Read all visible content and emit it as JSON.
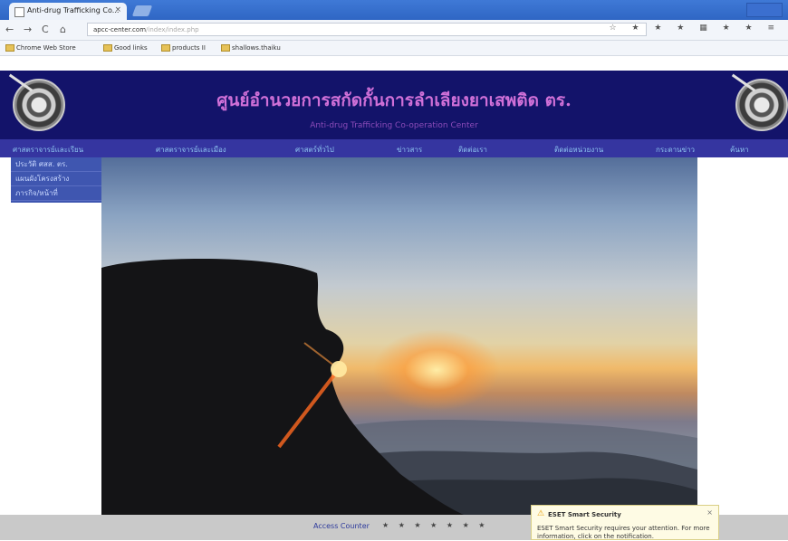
{
  "browser": {
    "tab_title": "Anti-drug Trafficking Co...",
    "tab_close": "×",
    "url_host": "apcc-center.com",
    "url_path": "/index/index.php",
    "nav": {
      "back": "←",
      "forward": "→",
      "reload": "C",
      "home": "⌂"
    },
    "toolbar_icons": "☆ ★ ★ ★ ▦ ★ ★ ≡",
    "bookmarks": [
      "Chrome Web Store",
      "Good links",
      "products II",
      "shallows.thaiku"
    ]
  },
  "page": {
    "title": "ศูนย์อำนวยการสกัดกั้นการลำเลียงยาเสพติด ตร.",
    "subtitle": "Anti-drug Trafficking Co-operation Center",
    "menu": [
      "ศาสตราจารย์และเรียน",
      "ศาสตราจารย์และเมือง",
      "ศาสตร์ทั่วไป",
      "ข่าวสาร",
      "ติดต่อเรา",
      "ติดต่อหน่วยงาน",
      "กระดานข่าว",
      "ค้นหา"
    ],
    "submenu": [
      "ประวัติ ศสส. ตร.",
      "แผนผังโครงสร้าง",
      "ภารกิจ/หน้าที่"
    ],
    "footer_link": "Access Counter",
    "footer_glyphs": "★ ★ ★ ★ ★ ★ ★"
  },
  "popup": {
    "title": "ESET Smart Security",
    "body": "ESET Smart Security requires your attention. For more information, click on the notification.",
    "close": "×"
  }
}
